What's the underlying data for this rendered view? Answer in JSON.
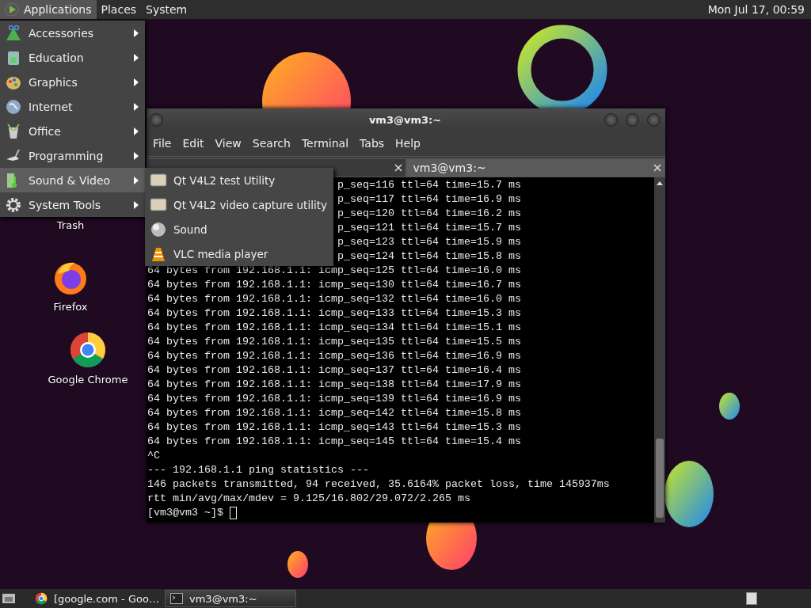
{
  "top_panel": {
    "menus": [
      {
        "label": "Applications",
        "selected": true
      },
      {
        "label": "Places",
        "selected": false
      },
      {
        "label": "System",
        "selected": false
      }
    ],
    "clock": "Mon Jul 17, 00:59"
  },
  "desktop_icons": [
    {
      "label": "Trash"
    },
    {
      "label": "Firefox"
    },
    {
      "label": "Google Chrome"
    }
  ],
  "terminal": {
    "title": "vm3@vm3:~",
    "menus": [
      "File",
      "Edit",
      "View",
      "Search",
      "Terminal",
      "Tabs",
      "Help"
    ],
    "tabs": [
      {
        "selected": true
      },
      {
        "label": "vm3@vm3:~",
        "selected": false
      }
    ],
    "lines": [
      {
        "kind": "covered",
        "text": "p_seq=116 ttl=64 time=15.7 ms"
      },
      {
        "kind": "covered",
        "text": "p_seq=117 ttl=64 time=16.9 ms"
      },
      {
        "kind": "covered",
        "text": "p_seq=120 ttl=64 time=16.2 ms"
      },
      {
        "kind": "covered",
        "text": "p_seq=121 ttl=64 time=15.7 ms"
      },
      {
        "kind": "covered",
        "text": "p_seq=123 ttl=64 time=15.9 ms"
      },
      {
        "kind": "covered",
        "text": "p_seq=124 ttl=64 time=15.8 ms"
      },
      {
        "kind": "output",
        "text": "64 bytes from 192.168.1.1: icmp_seq=125 ttl=64 time=16.0 ms"
      },
      {
        "kind": "output",
        "text": "64 bytes from 192.168.1.1: icmp_seq=130 ttl=64 time=16.7 ms"
      },
      {
        "kind": "output",
        "text": "64 bytes from 192.168.1.1: icmp_seq=132 ttl=64 time=16.0 ms"
      },
      {
        "kind": "output",
        "text": "64 bytes from 192.168.1.1: icmp_seq=133 ttl=64 time=15.3 ms"
      },
      {
        "kind": "output",
        "text": "64 bytes from 192.168.1.1: icmp_seq=134 ttl=64 time=15.1 ms"
      },
      {
        "kind": "output",
        "text": "64 bytes from 192.168.1.1: icmp_seq=135 ttl=64 time=15.5 ms"
      },
      {
        "kind": "output",
        "text": "64 bytes from 192.168.1.1: icmp_seq=136 ttl=64 time=16.9 ms"
      },
      {
        "kind": "output",
        "text": "64 bytes from 192.168.1.1: icmp_seq=137 ttl=64 time=16.4 ms"
      },
      {
        "kind": "output",
        "text": "64 bytes from 192.168.1.1: icmp_seq=138 ttl=64 time=17.9 ms"
      },
      {
        "kind": "output",
        "text": "64 bytes from 192.168.1.1: icmp_seq=139 ttl=64 time=16.9 ms"
      },
      {
        "kind": "output",
        "text": "64 bytes from 192.168.1.1: icmp_seq=142 ttl=64 time=15.8 ms"
      },
      {
        "kind": "output",
        "text": "64 bytes from 192.168.1.1: icmp_seq=143 ttl=64 time=15.3 ms"
      },
      {
        "kind": "output",
        "text": "64 bytes from 192.168.1.1: icmp_seq=145 ttl=64 time=15.4 ms"
      },
      {
        "kind": "output",
        "text": "^C"
      },
      {
        "kind": "output",
        "text": "--- 192.168.1.1 ping statistics ---"
      },
      {
        "kind": "output",
        "text": "146 packets transmitted, 94 received, 35.6164% packet loss, time 145937ms"
      },
      {
        "kind": "output",
        "text": "rtt min/avg/max/mdev = 9.125/16.802/29.072/2.265 ms"
      },
      {
        "kind": "prompt",
        "text": "[vm3@vm3 ~]$"
      }
    ]
  },
  "applications_menu": {
    "items": [
      {
        "label": "Accessories",
        "selected": false
      },
      {
        "label": "Education",
        "selected": false
      },
      {
        "label": "Graphics",
        "selected": false
      },
      {
        "label": "Internet",
        "selected": false
      },
      {
        "label": "Office",
        "selected": false
      },
      {
        "label": "Programming",
        "selected": false
      },
      {
        "label": "Sound & Video",
        "selected": true
      },
      {
        "label": "System Tools",
        "selected": false
      }
    ]
  },
  "submenu": {
    "items": [
      {
        "label": "Qt V4L2 test Utility"
      },
      {
        "label": "Qt V4L2 video capture utility"
      },
      {
        "label": "Sound"
      },
      {
        "label": "VLC media player"
      }
    ]
  },
  "taskbar": {
    "tasks": [
      {
        "label": "[google.com - Goo…",
        "selected": false
      },
      {
        "label": "vm3@vm3:~",
        "selected": true
      }
    ]
  }
}
